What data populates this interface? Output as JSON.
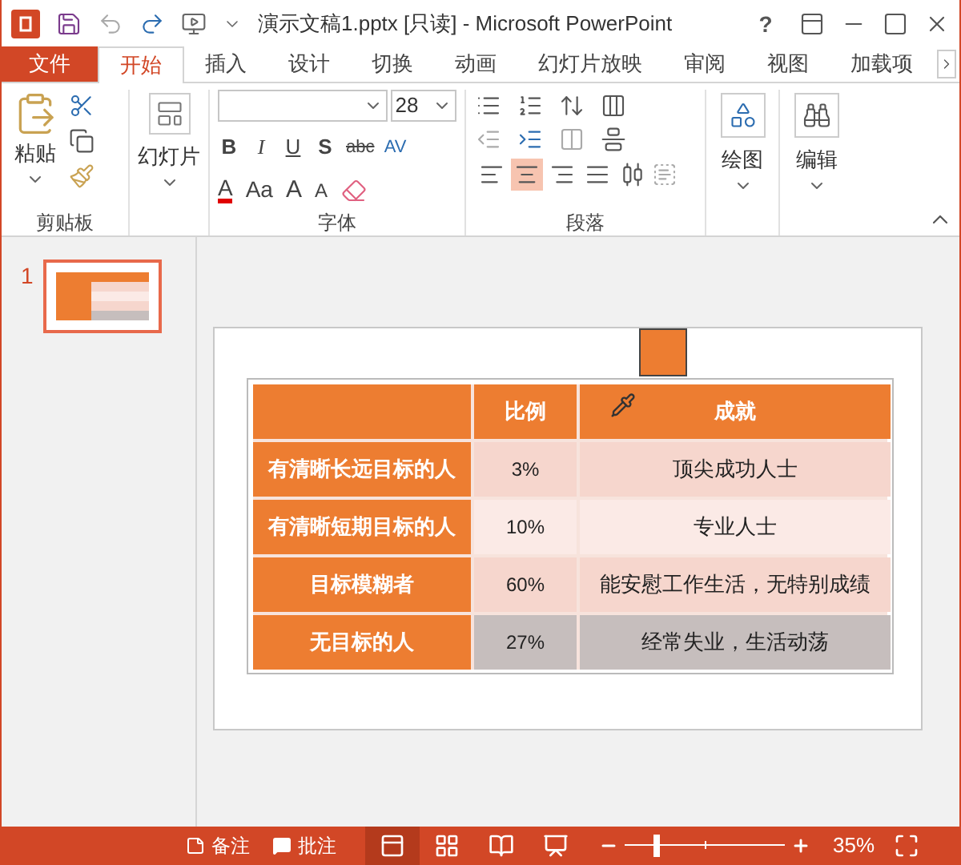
{
  "title_bar": {
    "title": "演示文稿1.pptx [只读] - Microsoft PowerPoint",
    "help": "?"
  },
  "tabs": [
    {
      "label": "文件",
      "kind": "file",
      "selected": false
    },
    {
      "label": "开始",
      "kind": "tab",
      "selected": true
    },
    {
      "label": "插入",
      "kind": "tab",
      "selected": false
    },
    {
      "label": "设计",
      "kind": "tab",
      "selected": false
    },
    {
      "label": "切换",
      "kind": "tab",
      "selected": false
    },
    {
      "label": "动画",
      "kind": "tab",
      "selected": false
    },
    {
      "label": "幻灯片放映",
      "kind": "tab",
      "selected": false
    },
    {
      "label": "审阅",
      "kind": "tab",
      "selected": false
    },
    {
      "label": "视图",
      "kind": "tab",
      "selected": false
    },
    {
      "label": "加载项",
      "kind": "tab",
      "selected": false
    }
  ],
  "ribbon": {
    "clipboard": {
      "paste_label": "粘贴",
      "group_label": "剪贴板"
    },
    "slides": {
      "label": "幻灯片"
    },
    "font": {
      "font_size": "28",
      "style_buttons": [
        "B",
        "I",
        "U",
        "S",
        "abc",
        "AV"
      ],
      "color_label": "A",
      "case_label": "Aa",
      "grow_label": "A",
      "shrink_label": "A",
      "group_label": "字体"
    },
    "paragraph": {
      "alignments": [
        {
          "kind": "left",
          "selected": false
        },
        {
          "kind": "center",
          "selected": true
        },
        {
          "kind": "right",
          "selected": false
        },
        {
          "kind": "justify",
          "selected": false
        },
        {
          "kind": "distributed",
          "selected": false
        }
      ],
      "group_label": "段落"
    },
    "drawing": {
      "label": "绘图"
    },
    "editing": {
      "label": "编辑"
    }
  },
  "slides_pane": {
    "slides": [
      {
        "number": "1",
        "selected": true
      }
    ]
  },
  "table": {
    "columns": [
      {
        "label": "比例"
      },
      {
        "label": "成就"
      }
    ],
    "rows": [
      {
        "label": "有清晰长远目标的人",
        "ratio": "3%",
        "result": "顶尖成功人士",
        "color": "#f6d6cd"
      },
      {
        "label": "有清晰短期目标的人",
        "ratio": "10%",
        "result": "专业人士",
        "color": "#fbeae6"
      },
      {
        "label": "目标模糊者",
        "ratio": "60%",
        "result": "能安慰工作生活，无特别成绩",
        "color": "#f6d6cd"
      },
      {
        "label": "无目标的人",
        "ratio": "27%",
        "result": "经常失业，生活动荡",
        "color": "#c6bebd"
      }
    ]
  },
  "status_bar": {
    "notes": "备注",
    "comments": "批注",
    "views": [
      {
        "kind": "normal",
        "selected": true
      },
      {
        "kind": "sorter",
        "selected": false
      },
      {
        "kind": "reading",
        "selected": false
      },
      {
        "kind": "slideshow",
        "selected": false
      }
    ],
    "zoom": {
      "level": 0.2,
      "reading": "35%"
    }
  }
}
